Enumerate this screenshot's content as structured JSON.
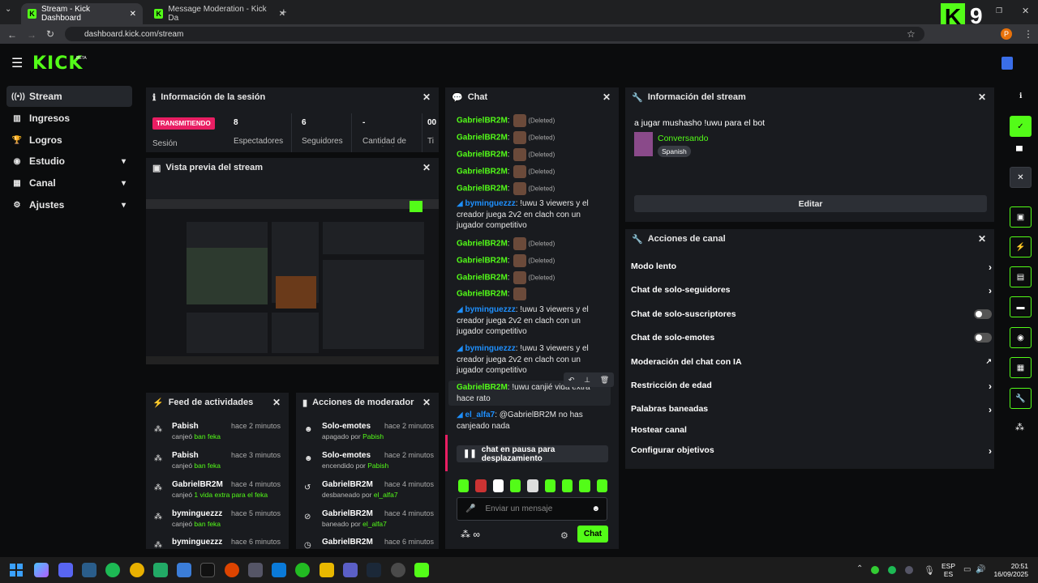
{
  "browser": {
    "tabs": [
      {
        "label": "Stream - Kick Dashboard"
      },
      {
        "label": "Message Moderation - Kick Da"
      }
    ],
    "url": "dashboard.kick.com/stream",
    "overlay_number": "9",
    "profile_initial": "P"
  },
  "header": {
    "logo": "KICK",
    "logo_badge": "BETA"
  },
  "sidebar": {
    "items": [
      {
        "label": "Stream"
      },
      {
        "label": "Ingresos"
      },
      {
        "label": "Logros"
      },
      {
        "label": "Estudio"
      },
      {
        "label": "Canal"
      },
      {
        "label": "Ajustes"
      }
    ]
  },
  "session": {
    "title": "Información de la sesión",
    "status_badge": "TRANSMITIENDO",
    "status_label": "Sesión",
    "stats": [
      {
        "value": "8",
        "label": "Espectadores"
      },
      {
        "value": "6",
        "label": "Seguidores"
      },
      {
        "value": "-",
        "label": "Cantidad de suscripciones"
      },
      {
        "value": "00",
        "label": "Ti"
      }
    ]
  },
  "preview": {
    "title": "Vista previa del stream"
  },
  "activity": {
    "title": "Feed de actividades",
    "items": [
      {
        "name": "Pabish",
        "time": "hace 2 minutos",
        "pre": "canjeó ",
        "reward": "ban feka"
      },
      {
        "name": "Pabish",
        "time": "hace 3 minutos",
        "pre": "canjeó ",
        "reward": "ban feka"
      },
      {
        "name": "GabrielBR2M",
        "time": "hace 4 minutos",
        "pre": "canjeó ",
        "reward": "1 vida extra para el feka"
      },
      {
        "name": "byminguezzz",
        "time": "hace 5 minutos",
        "pre": "canjeó ",
        "reward": "ban feka"
      },
      {
        "name": "byminguezzz",
        "time": "hace 6 minutos",
        "pre": "",
        "reward": ""
      }
    ]
  },
  "modactions": {
    "title": "Acciones de moderador",
    "items": [
      {
        "name": "Solo-emotes",
        "time": "hace 2 minutos",
        "pre": "apagado por ",
        "by": "Pabish"
      },
      {
        "name": "Solo-emotes",
        "time": "hace 2 minutos",
        "pre": "encendido por ",
        "by": "Pabish"
      },
      {
        "name": "GabrielBR2M",
        "time": "hace 4 minutos",
        "pre": "desbaneado por ",
        "by": "el_alfa7"
      },
      {
        "name": "GabrielBR2M",
        "time": "hace 4 minutos",
        "pre": "baneado por ",
        "by": "el_alfa7"
      },
      {
        "name": "GabrielBR2M",
        "time": "hace 6 minutos",
        "pre": "",
        "by": ""
      }
    ]
  },
  "chat": {
    "title": "Chat",
    "deleted_label": "(Deleted)",
    "messages": [
      {
        "user": "GabrielBR2M",
        "text": "(Deleted)"
      },
      {
        "user": "GabrielBR2M",
        "text": "(Deleted)"
      },
      {
        "user": "GabrielBR2M",
        "text": "(Deleted)"
      },
      {
        "user": "GabrielBR2M",
        "text": "(Deleted)"
      },
      {
        "user": "GabrielBR2M",
        "text": "(Deleted)"
      },
      {
        "user": "byminguezzz",
        "text": "!uwu 3 viewers y el creador juega 2v2 en clach con un jugador competitivo"
      },
      {
        "user": "GabrielBR2M",
        "text": "(Deleted)"
      },
      {
        "user": "GabrielBR2M",
        "text": "(Deleted)"
      },
      {
        "user": "GabrielBR2M",
        "text": "(Deleted)"
      },
      {
        "user": "GabrielBR2M",
        "text": ""
      },
      {
        "user": "byminguezzz",
        "text": "!uwu 3 viewers y el creador juega 2v2 en clach con un jugador competitivo"
      },
      {
        "user": "byminguezzz",
        "text": "!uwu 3 viewers y el creador juega 2v2 en clach con un jugador competitivo"
      },
      {
        "user": "GabrielBR2M",
        "text": "!uwu canjié vida extra hace rato"
      },
      {
        "user": "el_alfa7",
        "text": "@GabrielBR2M no has canjeado nada"
      }
    ],
    "paused": "chat en pausa para desplazamiento",
    "placeholder": "Enviar un mensaje",
    "send": "Chat",
    "points": "∞"
  },
  "streaminfo": {
    "title": "Información del stream",
    "stream_title": "a jugar mushasho !uwu para el bot",
    "category": "Conversando",
    "language": "Spanish",
    "edit": "Editar"
  },
  "channel": {
    "title": "Acciones de canal",
    "items": [
      {
        "label": "Modo lento",
        "kind": "chevron"
      },
      {
        "label": "Chat de solo-seguidores",
        "kind": "chevron"
      },
      {
        "label": "Chat de solo-suscriptores",
        "kind": "toggle"
      },
      {
        "label": "Chat de solo-emotes",
        "kind": "toggle"
      },
      {
        "label": "Moderación del chat con IA",
        "kind": "external"
      },
      {
        "label": "Restricción de edad",
        "kind": "chevron"
      },
      {
        "label": "Palabras baneadas",
        "kind": "chevron"
      },
      {
        "label": "Hostear canal",
        "kind": "none"
      },
      {
        "label": "Configurar objetivos",
        "kind": "chevron"
      }
    ]
  },
  "tray": {
    "lang": "ESP",
    "lang2": "ES",
    "time": "20:51",
    "date": "16/09/2025"
  },
  "colors": {
    "accent": "#53fc18",
    "live": "#e91e63",
    "panel": "#191b1f"
  }
}
